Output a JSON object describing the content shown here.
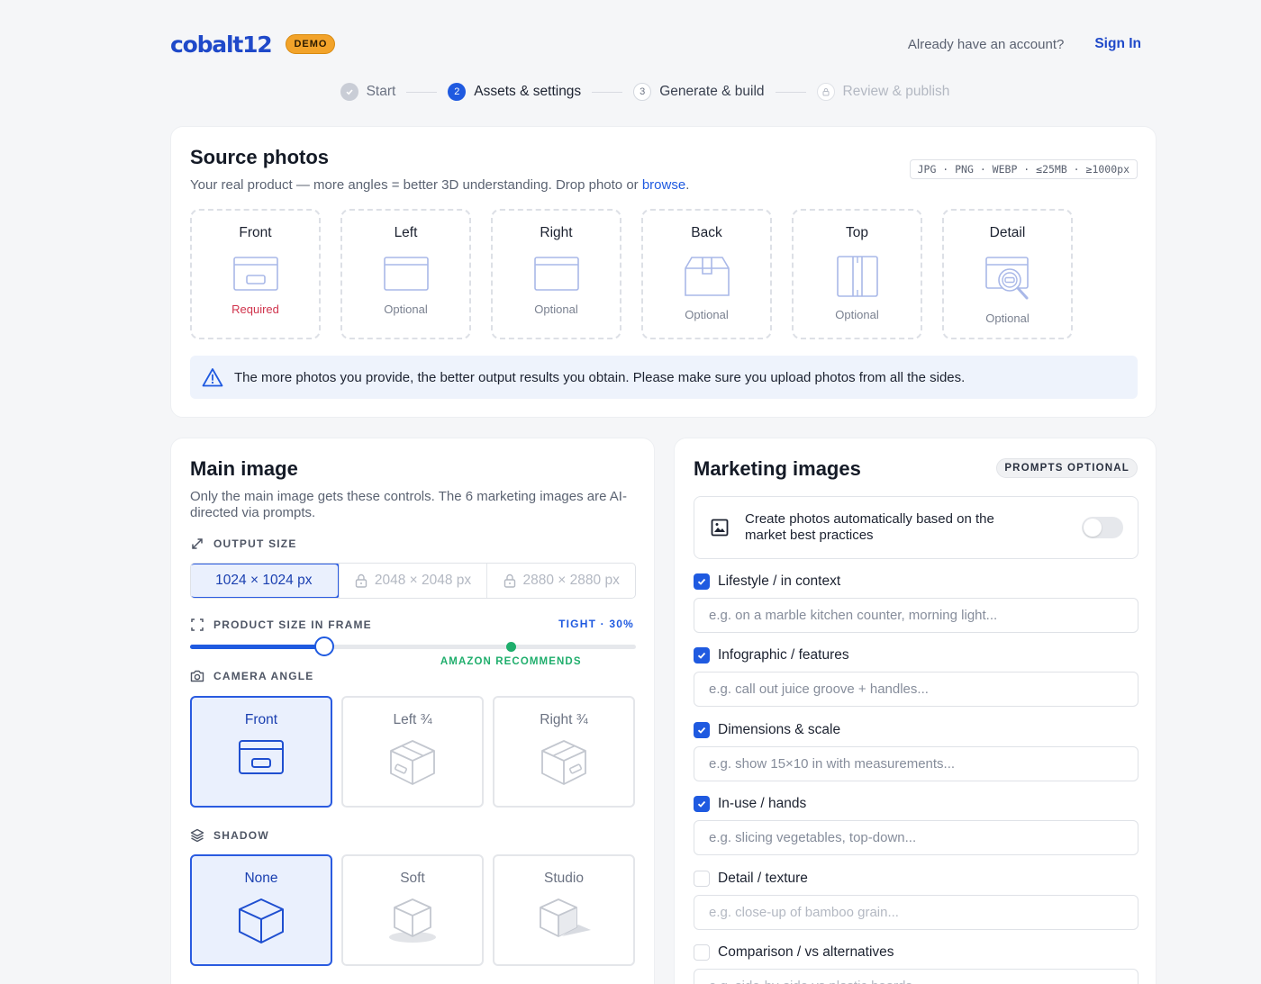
{
  "header": {
    "logo": "cobalt12",
    "demo_badge": "DEMO",
    "account_question": "Already have an account?",
    "signin_label": "Sign In"
  },
  "stepper": [
    {
      "num": "",
      "label": "Start",
      "state": "done"
    },
    {
      "num": "2",
      "label": "Assets & settings",
      "state": "active"
    },
    {
      "num": "3",
      "label": "Generate & build",
      "state": "next"
    },
    {
      "num": "",
      "label": "Review & publish",
      "state": "locked"
    }
  ],
  "source": {
    "title": "Source photos",
    "subtitle": "Your real product — more angles = better 3D understanding. Drop photo or",
    "browse": "browse",
    "subtitle_end": ".",
    "formats": "JPG · PNG · WEBP · ≤25MB · ≥1000px",
    "slots": [
      {
        "label": "Front",
        "status": "Required",
        "icon": "box-front-icon"
      },
      {
        "label": "Left",
        "status": "Optional",
        "icon": "box-side-icon"
      },
      {
        "label": "Right",
        "status": "Optional",
        "icon": "box-side-icon"
      },
      {
        "label": "Back",
        "status": "Optional",
        "icon": "box-back-icon"
      },
      {
        "label": "Top",
        "status": "Optional",
        "icon": "box-top-icon"
      },
      {
        "label": "Detail",
        "status": "Optional",
        "icon": "magnifier-icon"
      }
    ],
    "notice": "The more photos you provide, the better output results you obtain. Please make sure you upload photos from all the sides."
  },
  "main_image": {
    "title": "Main image",
    "subtitle": "Only the main image gets these controls. The 6 marketing images are AI-directed via prompts.",
    "output_size_label": "OUTPUT SIZE",
    "sizes": [
      "1024 × 1024 px",
      "2048 × 2048 px",
      "2880 × 2880 px"
    ],
    "product_size_label": "PRODUCT SIZE IN FRAME",
    "product_size_value": "TIGHT · 30%",
    "slider_value": 0.3,
    "slider_recommended": 0.72,
    "recommend_label": "AMAZON RECOMMENDS",
    "camera_angle_label": "CAMERA ANGLE",
    "angles": [
      "Front",
      "Left ¾",
      "Right ¾"
    ],
    "shadow_label": "SHADOW",
    "shadows": [
      "None",
      "Soft",
      "Studio"
    ]
  },
  "marketing": {
    "title": "Marketing images",
    "badge": "PROMPTS OPTIONAL",
    "auto_text": "Create photos automatically based on the market best practices",
    "auto_enabled": false,
    "prompts": [
      {
        "label": "Lifestyle / in context",
        "checked": true,
        "placeholder": "e.g. on a marble kitchen counter, morning light..."
      },
      {
        "label": "Infographic / features",
        "checked": true,
        "placeholder": "e.g. call out juice groove + handles..."
      },
      {
        "label": "Dimensions & scale",
        "checked": true,
        "placeholder": "e.g. show 15×10 in with measurements..."
      },
      {
        "label": "In-use / hands",
        "checked": true,
        "placeholder": "e.g. slicing vegetables, top-down..."
      },
      {
        "label": "Detail / texture",
        "checked": false,
        "placeholder": "e.g. close-up of bamboo grain..."
      },
      {
        "label": "Comparison / vs alternatives",
        "checked": false,
        "placeholder": "e.g. side-by-side vs plastic boards..."
      }
    ]
  },
  "colors": {
    "accent": "#1f5ae0",
    "brand": "#1f49c9",
    "required": "#d0334c",
    "recommend": "#1fae6c",
    "demo": "#f2a32a"
  }
}
